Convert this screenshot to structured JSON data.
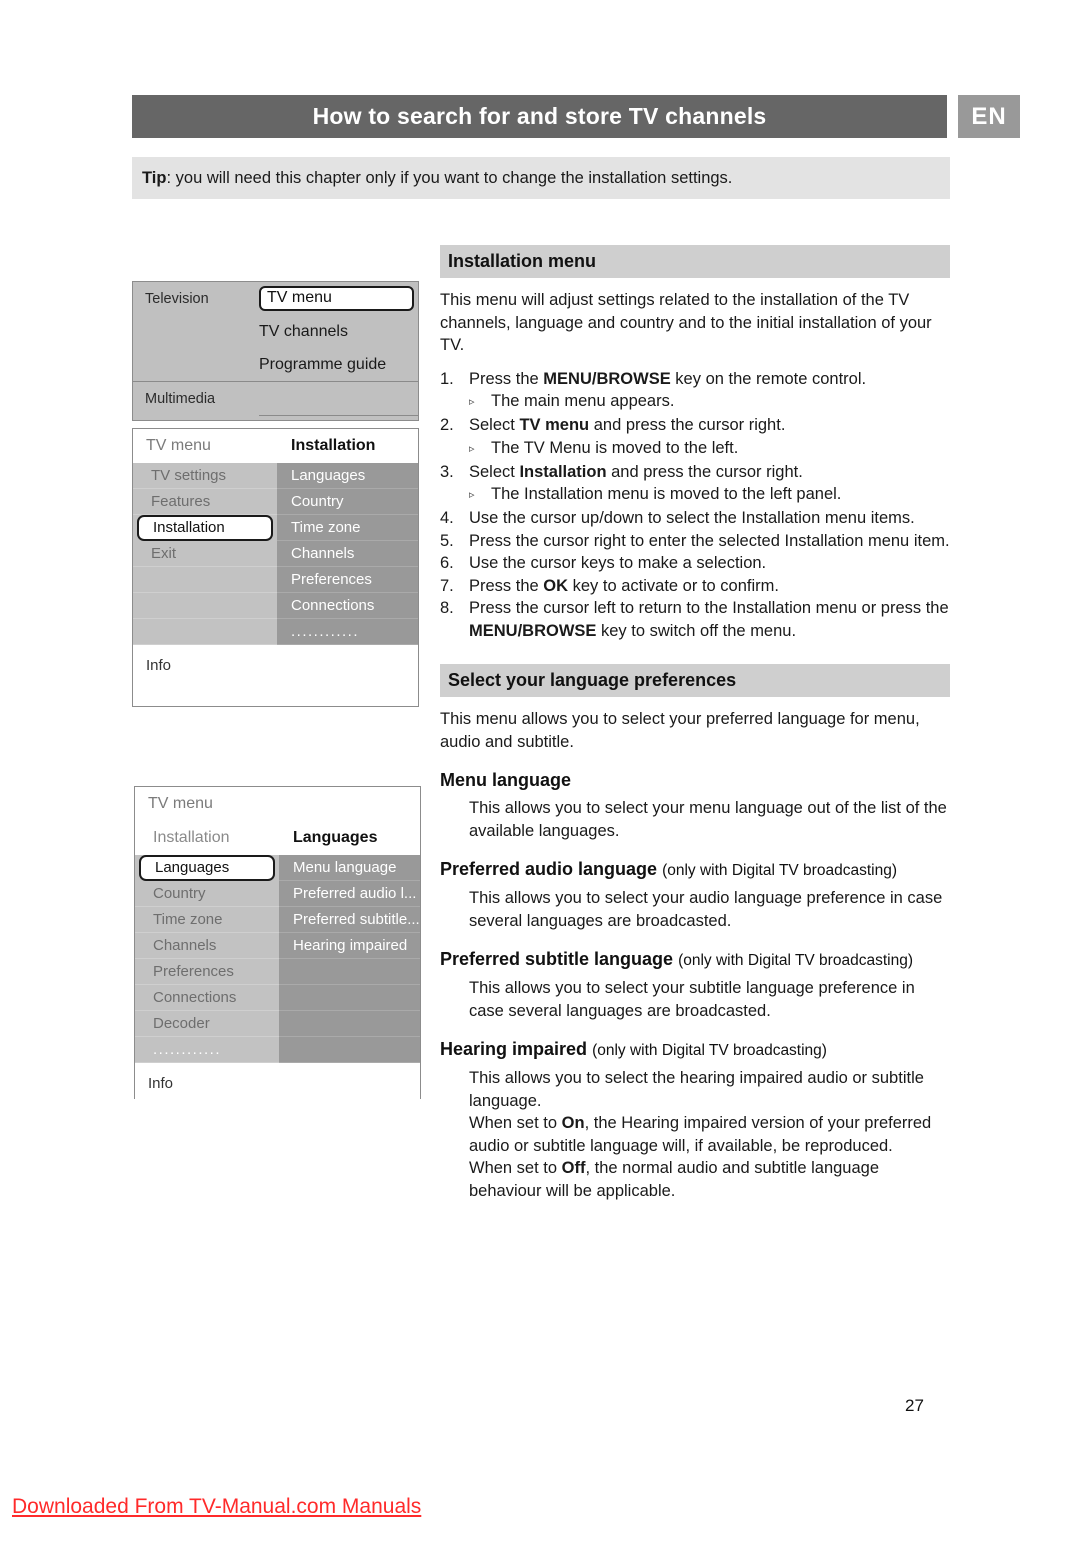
{
  "header": {
    "title": "How to search for and store TV channels",
    "language_badge": "EN",
    "bar_color": "#666666",
    "badge_color": "#999999"
  },
  "tip": {
    "label": "Tip",
    "separator": ":",
    "text": "you will need this chapter only if you want to change the installation settings."
  },
  "menu_mockup_1": {
    "rows": [
      {
        "left": "Television",
        "right": "TV menu",
        "selected": true
      },
      {
        "left": "",
        "right": "TV channels",
        "selected": false
      },
      {
        "left": "",
        "right": "Programme guide",
        "selected": false
      },
      {
        "left": "Multimedia",
        "right": "",
        "selected": false
      },
      {
        "left": "",
        "right": "",
        "selected": false
      }
    ]
  },
  "menu_mockup_2": {
    "header": {
      "left": "TV menu",
      "right": "Installation"
    },
    "left_items": [
      {
        "label": "TV settings",
        "selected": false
      },
      {
        "label": "Features",
        "selected": false
      },
      {
        "label": "Installation",
        "selected": true
      },
      {
        "label": "Exit",
        "selected": false
      },
      {
        "label": "",
        "selected": false
      },
      {
        "label": "",
        "selected": false
      },
      {
        "label": "",
        "selected": false
      }
    ],
    "right_items": [
      {
        "label": "Languages"
      },
      {
        "label": "Country"
      },
      {
        "label": "Time zone"
      },
      {
        "label": "Channels"
      },
      {
        "label": "Preferences"
      },
      {
        "label": "Connections"
      },
      {
        "label": "............"
      }
    ],
    "info_label": "Info"
  },
  "menu_mockup_3": {
    "header_top": "TV menu",
    "header_sub": {
      "left": "Installation",
      "right": "Languages"
    },
    "left_items": [
      {
        "label": "Languages",
        "selected": true
      },
      {
        "label": "Country",
        "selected": false
      },
      {
        "label": "Time zone",
        "selected": false
      },
      {
        "label": "Channels",
        "selected": false
      },
      {
        "label": "Preferences",
        "selected": false
      },
      {
        "label": "Connections",
        "selected": false
      },
      {
        "label": "Decoder",
        "selected": false
      },
      {
        "label": "............",
        "selected": false
      }
    ],
    "right_items": [
      {
        "label": "Menu language"
      },
      {
        "label": "Preferred audio l..."
      },
      {
        "label": "Preferred subtitle..."
      },
      {
        "label": "Hearing impaired"
      },
      {
        "label": ""
      },
      {
        "label": ""
      },
      {
        "label": ""
      },
      {
        "label": ""
      }
    ],
    "info_label": "Info"
  },
  "installation_section": {
    "heading": "Installation menu",
    "intro": "This menu will adjust settings related to the installation of the TV channels, language and country and to the initial installation of your TV.",
    "steps": [
      {
        "num": "1.",
        "pre": "Press the ",
        "kw": "MENU/BROWSE",
        "post": " key on the remote control."
      },
      {
        "num": "▹",
        "pre": "The main menu appears.",
        "kw": "",
        "post": "",
        "is_note": true
      },
      {
        "num": "2.",
        "pre": "Select ",
        "kw": "TV menu",
        "post": " and press the cursor right."
      },
      {
        "num": "▹",
        "pre": "The TV Menu is moved to the left.",
        "kw": "",
        "post": "",
        "is_note": true
      },
      {
        "num": "3.",
        "pre": "Select ",
        "kw": "Installation",
        "post": " and press the cursor right."
      },
      {
        "num": "▹",
        "pre": "The Installation menu is moved to the left panel.",
        "kw": "",
        "post": "",
        "is_note": true
      },
      {
        "num": "4.",
        "pre": "Use the cursor up/down to select the Installation menu items.",
        "kw": "",
        "post": ""
      },
      {
        "num": "5.",
        "pre": "Press the cursor right to enter the selected Installation menu item.",
        "kw": "",
        "post": ""
      },
      {
        "num": "6.",
        "pre": "Use the cursor keys to make a selection.",
        "kw": "",
        "post": ""
      },
      {
        "num": "7.",
        "pre": "Press the ",
        "kw": "OK",
        "post": " key to activate or to confirm."
      },
      {
        "num": "8.",
        "pre": "Press the cursor left to return to the Installation menu or press the ",
        "kw": "MENU/BROWSE",
        "post": " key to switch off the menu."
      }
    ]
  },
  "language_section": {
    "heading": "Select your language preferences",
    "intro": "This menu allows you to select your preferred language for menu, audio and subtitle.",
    "items": [
      {
        "title": "Menu language",
        "qualifier": "",
        "body": "This allows you to select your menu language out of the list of the available languages."
      },
      {
        "title": "Preferred audio language",
        "qualifier": "(only with Digital TV broadcasting)",
        "body": "This allows you to select your audio language preference in case several languages are broadcasted."
      },
      {
        "title": "Preferred subtitle language",
        "qualifier": "(only with Digital TV broadcasting)",
        "body": "This allows you to select your subtitle language preference in case several languages are broadcasted."
      },
      {
        "title": "Hearing impaired",
        "qualifier": "(only with Digital TV broadcasting)",
        "body": "This allows you to select the hearing impaired audio or subtitle language."
      }
    ],
    "on_text_pre": "When set to ",
    "on_kw": "On",
    "on_text_post": ", the Hearing impaired version of your preferred audio or subtitle language will, if available, be reproduced.",
    "off_text_pre": "When set to ",
    "off_kw": "Off",
    "off_text_post": ", the normal audio and subtitle language behaviour will be applicable."
  },
  "footer": {
    "page_number": "27",
    "download_notice": "Downloaded From TV-Manual.com Manuals",
    "notice_color": "#ff2a2a"
  }
}
